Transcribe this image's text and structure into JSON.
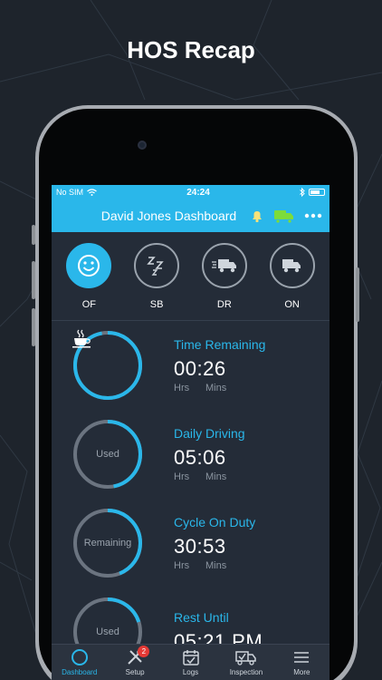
{
  "headline": "HOS Recap",
  "statusbar": {
    "carrier": "No SIM",
    "time": "24:24"
  },
  "navbar": {
    "title": "David Jones Dashboard"
  },
  "statuses": [
    {
      "label": "OF",
      "icon": "smiley-icon",
      "active": true
    },
    {
      "label": "SB",
      "icon": "sleep-zzz-icon",
      "active": false
    },
    {
      "label": "DR",
      "icon": "moving-truck-icon",
      "active": false
    },
    {
      "label": "ON",
      "icon": "truck-icon",
      "active": false
    }
  ],
  "timers": [
    {
      "title": "Time Remaining",
      "hours": "00",
      "mins": "26",
      "ring_label": "",
      "icon": "coffee-cup-icon",
      "progress": 0.97
    },
    {
      "title": "Daily Driving",
      "hours": "05",
      "mins": "06",
      "ring_label": "Used",
      "icon": "",
      "progress": 0.47
    },
    {
      "title": "Cycle On Duty",
      "hours": "30",
      "mins": "53",
      "ring_label": "Remaining",
      "icon": "",
      "progress": 0.44
    },
    {
      "title": "Rest Until",
      "value": "05:21 PM",
      "ring_label": "Used",
      "icon": "",
      "progress": 0.2
    }
  ],
  "units": {
    "hours": "Hrs",
    "mins": "Mins"
  },
  "tabs": [
    {
      "label": "Dashboard",
      "icon": "dashboard-ring-icon",
      "active": true
    },
    {
      "label": "Setup",
      "icon": "tools-icon",
      "badge": "2"
    },
    {
      "label": "Logs",
      "icon": "calendar-check-icon"
    },
    {
      "label": "Inspection",
      "icon": "truck-check-icon"
    },
    {
      "label": "More",
      "icon": "menu-icon"
    }
  ],
  "colors": {
    "accent": "#2ab7ea",
    "screen_bg": "#242c38",
    "ring_track": "#6b7480",
    "badge": "#e53935"
  }
}
